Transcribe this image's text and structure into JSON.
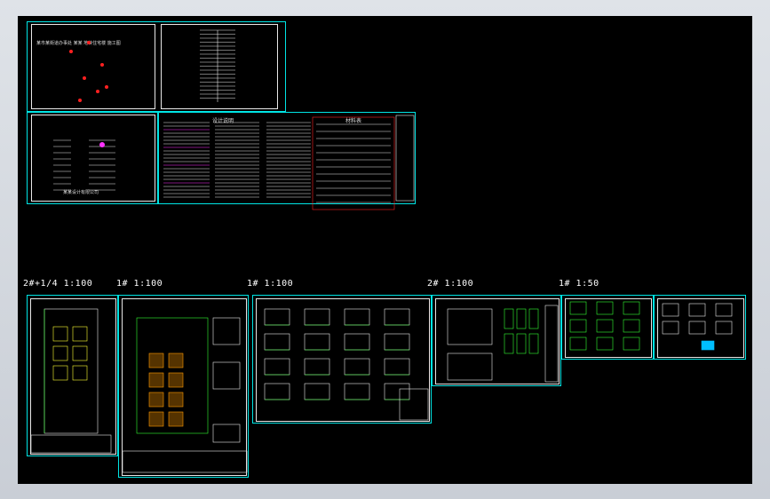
{
  "colors": {
    "background": "#000000",
    "sheet_border": "#00e5e5",
    "line_white": "#e8e8e8",
    "line_green": "#33ff33",
    "line_yellow": "#ffff33",
    "line_magenta": "#ff33ff",
    "line_red": "#ff2020",
    "line_orange": "#ff9900"
  },
  "cover": {
    "title": "某市某街道办事处 某某 地块住宅楼 施工图",
    "subtitle": "某某设计有限公司"
  },
  "scale_labels": [
    "2#+1/4 1:100",
    "1# 1:100",
    "1# 1:100",
    "2# 1:100",
    "1# 1:50"
  ],
  "design_notes_title": "设计说明",
  "material_table_title": "材料表"
}
